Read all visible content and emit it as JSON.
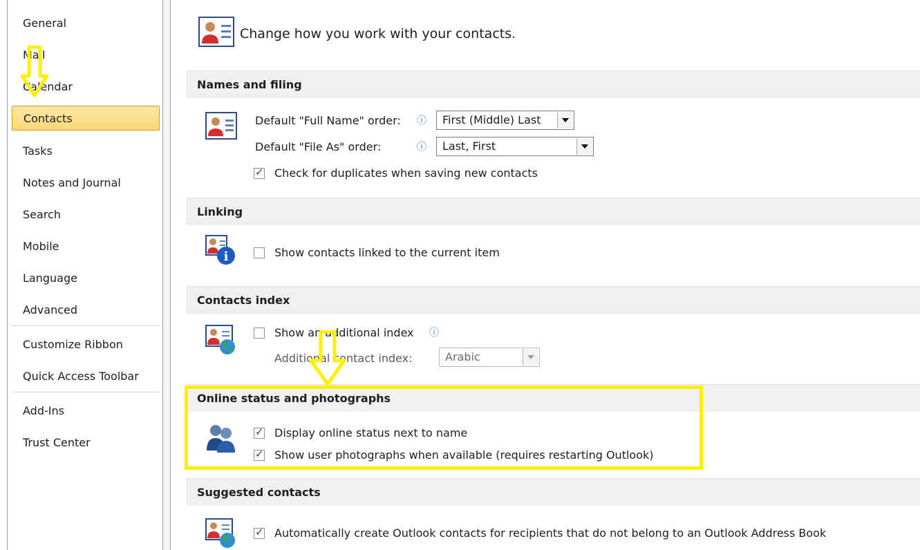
{
  "sidebar": {
    "items": [
      {
        "label": "General"
      },
      {
        "label": "Mail"
      },
      {
        "label": "Calendar"
      },
      {
        "label": "Contacts"
      },
      {
        "label": "Tasks"
      },
      {
        "label": "Notes and Journal"
      },
      {
        "label": "Search"
      },
      {
        "label": "Mobile"
      },
      {
        "label": "Language"
      },
      {
        "label": "Advanced"
      },
      {
        "label": "Customize Ribbon"
      },
      {
        "label": "Quick Access Toolbar"
      },
      {
        "label": "Add-Ins"
      },
      {
        "label": "Trust Center"
      }
    ],
    "selected": "Contacts"
  },
  "main": {
    "header": "Change how you work with your contacts.",
    "names": {
      "title": "Names and filing",
      "full_name_label": "Default \"Full Name\" order:",
      "full_name_value": "First (Middle) Last",
      "file_as_label": "Default \"File As\" order:",
      "file_as_value": "Last, First",
      "duplicates_label": "Check for duplicates when saving new contacts",
      "duplicates_checked": true
    },
    "linking": {
      "title": "Linking",
      "show_linked_label": "Show contacts linked to the current item",
      "show_linked_checked": false
    },
    "index": {
      "title": "Contacts index",
      "show_index_label": "Show an additional index",
      "show_index_checked": false,
      "additional_label": "Additional contact index:",
      "additional_value": "Arabic"
    },
    "online": {
      "title": "Online status and photographs",
      "display_status_label": "Display online status next to name",
      "display_status_checked": true,
      "show_photos_label": "Show user photographs when available (requires restarting Outlook)",
      "show_photos_checked": true
    },
    "suggested": {
      "title": "Suggested contacts",
      "auto_create_label": "Automatically create Outlook contacts for recipients that do not belong to an Outlook Address Book",
      "auto_create_checked": true
    }
  },
  "colors": {
    "selected_bg": "#fbd77a",
    "selected_border": "#e39c27",
    "annotation": "#ffef00",
    "checkmark": "#2a3e8c"
  }
}
